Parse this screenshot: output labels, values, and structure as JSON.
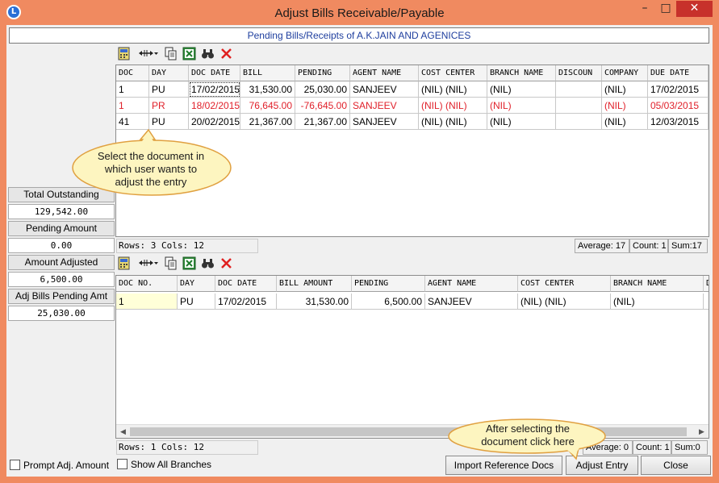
{
  "window": {
    "title": "Adjust Bills Receivable/Payable",
    "app_icon_glyph": "L",
    "controls": {
      "minimize": "–",
      "maximize": "□",
      "close": "✕"
    },
    "accent": "#f08a60"
  },
  "header": {
    "text": "Pending Bills/Receipts of A.K.JAIN AND AGENICES"
  },
  "summary": [
    {
      "label": "Total Outstanding",
      "value": "129,542.00"
    },
    {
      "label": "Pending Amount",
      "value": "0.00"
    },
    {
      "label": "Amount Adjusted",
      "value": "6,500.00"
    },
    {
      "label": "Adj Bills Pending Amt",
      "value": "25,030.00"
    }
  ],
  "toolbar_icons": [
    "calculator-icon",
    "column-width-icon",
    "copy-icon",
    "excel-icon",
    "find-icon",
    "delete-icon"
  ],
  "grid1": {
    "columns": [
      "DOC",
      "DAY",
      "DOC DATE",
      "BILL",
      "PENDING",
      "AGENT NAME",
      "COST CENTER",
      "BRANCH NAME",
      "DISCOUN",
      "COMPANY",
      "DUE DATE"
    ],
    "rows": [
      {
        "cells": [
          "1",
          "PU",
          "17/02/2015",
          "31,530.00",
          "25,030.00",
          "SANJEEV",
          "(NIL) (NIL)",
          "(NIL)",
          "",
          "(NIL)",
          "17/02/2015"
        ],
        "highlight": false
      },
      {
        "cells": [
          "1",
          "PR",
          "18/02/2015",
          "76,645.00",
          "-76,645.00",
          "SANJEEV",
          "(NIL) (NIL)",
          "(NIL)",
          "",
          "(NIL)",
          "05/03/2015"
        ],
        "highlight": true
      },
      {
        "cells": [
          "41",
          "PU",
          "20/02/2015",
          "21,367.00",
          "21,367.00",
          "SANJEEV",
          "(NIL) (NIL)",
          "(NIL)",
          "",
          "(NIL)",
          "12/03/2015"
        ],
        "highlight": false
      }
    ],
    "status": "Rows: 3  Cols: 12",
    "average": "Average: 17",
    "count": "Count: 1",
    "sum": "Sum:17",
    "highlight_color": "#e0202a"
  },
  "grid2": {
    "columns": [
      "DOC NO.",
      "DAY",
      "DOC DATE",
      "BILL AMOUNT",
      "PENDING",
      "AGENT NAME",
      "COST CENTER",
      "BRANCH NAME",
      "D"
    ],
    "rows": [
      {
        "cells": [
          "1",
          "PU",
          "17/02/2015",
          "31,530.00",
          "6,500.00",
          "SANJEEV",
          "(NIL) (NIL)",
          "(NIL)",
          ""
        ]
      }
    ],
    "status": "Rows: 1  Cols: 12",
    "average": "Average: 0",
    "count": "Count: 1",
    "sum": "Sum:0"
  },
  "options": {
    "prompt_adj_amount": "Prompt Adj. Amount",
    "show_all_branches": "Show All Branches"
  },
  "buttons": {
    "import_reference_docs": "Import Reference Docs",
    "adjust_entry": "Adjust Entry",
    "close": "Close"
  },
  "callouts": {
    "select_document": "Select the document in which user wants to adjust the entry",
    "click_here": "After selecting the document click here",
    "fill_color": "#fdf5c0",
    "stroke_color": "#e0a040"
  }
}
